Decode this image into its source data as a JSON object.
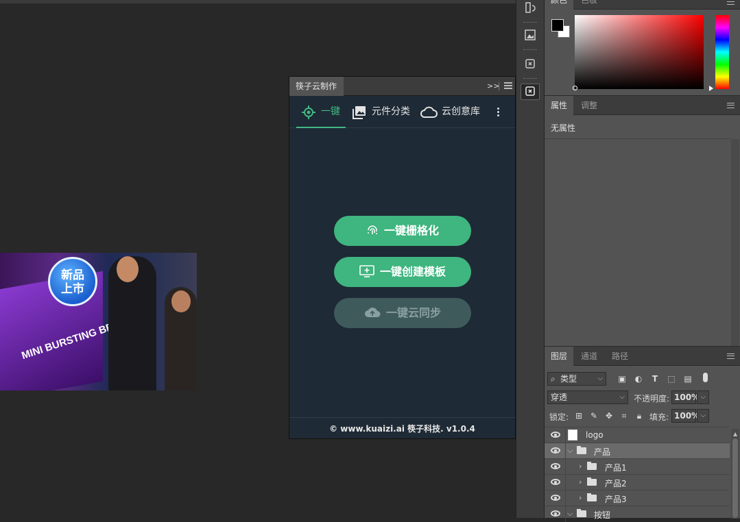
{
  "document": {
    "badge_text": "新品\n上市",
    "pack_text": "MINI BURSTING BEADS"
  },
  "plugin": {
    "tab_title": "筷子云制作",
    "collapse_glyph": ">>",
    "nav": {
      "onekey_label": "一键",
      "components_label": "元件分类",
      "cloud_label": "云创意库"
    },
    "buttons": {
      "rasterize": "一键栅格化",
      "create_template": "一键创建模板",
      "cloud_sync": "一键云同步"
    },
    "footer": "© www.kuaizi.ai 筷子科技. v1.0.4",
    "accent_color": "#42b883"
  },
  "color_panel": {
    "tabs": [
      "颜色",
      "色板"
    ]
  },
  "props_panel": {
    "tabs": [
      "属性",
      "调整"
    ],
    "empty_text": "无属性"
  },
  "layers_panel": {
    "tabs": [
      "图层",
      "通道",
      "路径"
    ],
    "filter_kind": "类型",
    "blend_mode": "穿透",
    "opacity_label": "不透明度:",
    "opacity_value": "100%",
    "lock_label": "锁定:",
    "fill_label": "填充:",
    "fill_value": "100%",
    "layers": [
      {
        "name": "logo",
        "type": "smart"
      },
      {
        "name": "产品",
        "type": "group",
        "expanded": true,
        "selected": true
      },
      {
        "name": "产品1",
        "type": "group",
        "expanded": false
      },
      {
        "name": "产品2",
        "type": "group",
        "expanded": false
      },
      {
        "name": "产品3",
        "type": "group",
        "expanded": false
      },
      {
        "name": "按钮",
        "type": "group",
        "expanded": true
      }
    ]
  }
}
